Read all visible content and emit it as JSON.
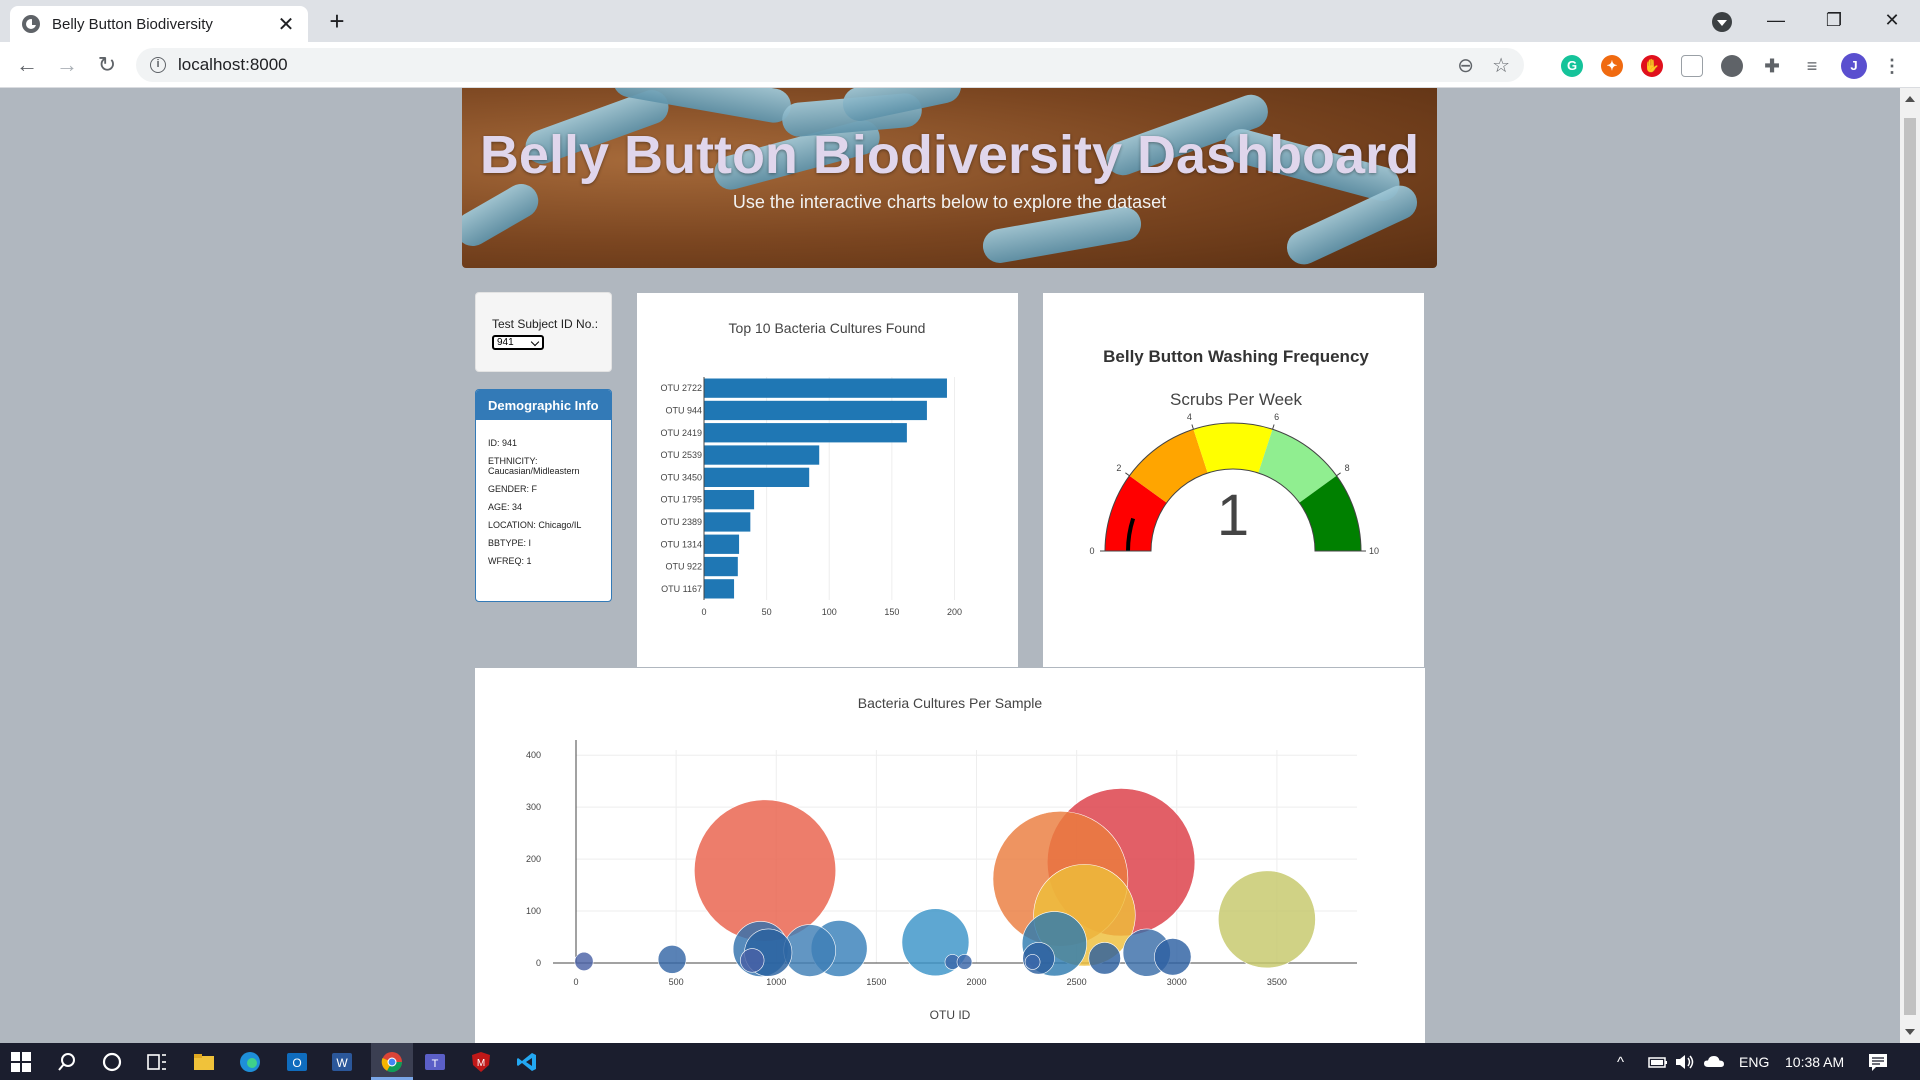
{
  "browser": {
    "tab_title": "Belly Button Biodiversity",
    "tab_close": "✕",
    "new_tab": "+",
    "url": "localhost:8000",
    "window_minimize": "—",
    "window_restore": "❐",
    "window_close": "✕",
    "profile_initial": "J"
  },
  "header": {
    "title": "Belly Button Biodiversity Dashboard",
    "subtitle": "Use the interactive charts below to explore the dataset"
  },
  "selector": {
    "label": "Test Subject ID No.:",
    "value": "941"
  },
  "demographic": {
    "heading": "Demographic Info",
    "rows": [
      "ID: 941",
      "ETHNICITY: Caucasian/Midleastern",
      "GENDER: F",
      "AGE: 34",
      "LOCATION: Chicago/IL",
      "BBTYPE: I",
      "WFREQ: 1"
    ]
  },
  "chart_data": [
    {
      "type": "bar",
      "orientation": "horizontal",
      "title": "Top 10 Bacteria Cultures Found",
      "categories": [
        "OTU 2722",
        "OTU 944",
        "OTU 2419",
        "OTU 2539",
        "OTU 3450",
        "OTU 1795",
        "OTU 2389",
        "OTU 1314",
        "OTU 922",
        "OTU 1167"
      ],
      "values": [
        194,
        178,
        162,
        92,
        84,
        40,
        37,
        28,
        27,
        24
      ],
      "xlim": [
        0,
        210
      ],
      "xticks": [
        0,
        50,
        100,
        150,
        200
      ],
      "color": "#1f77b4",
      "grid": true
    },
    {
      "type": "gauge",
      "title": "Belly Button Washing Frequency",
      "subtitle": "Scrubs Per Week",
      "value": 1,
      "range": [
        0,
        10
      ],
      "tick_labels": [
        "0",
        "2",
        "4",
        "6",
        "8",
        "10"
      ],
      "bands": [
        {
          "from": 0,
          "to": 2,
          "color": "#ff0000"
        },
        {
          "from": 2,
          "to": 4,
          "color": "#ffa500"
        },
        {
          "from": 4,
          "to": 6,
          "color": "#ffff00"
        },
        {
          "from": 6,
          "to": 8,
          "color": "#90ee90"
        },
        {
          "from": 8,
          "to": 10,
          "color": "#008000"
        }
      ],
      "bar_color": "#000000"
    },
    {
      "type": "scatter",
      "subtype": "bubble",
      "title": "Bacteria Cultures Per Sample",
      "xlabel": "OTU ID",
      "ylabel": "",
      "xlim": [
        0,
        3900
      ],
      "ylim": [
        0,
        410
      ],
      "xticks": [
        0,
        500,
        1000,
        1500,
        2000,
        2500,
        3000,
        3500
      ],
      "yticks": [
        0,
        100,
        200,
        300,
        400
      ],
      "grid": true,
      "points": [
        {
          "x": 2722,
          "y": 194,
          "color": "#dc3c46"
        },
        {
          "x": 944,
          "y": 178,
          "color": "#e9604a"
        },
        {
          "x": 2419,
          "y": 162,
          "color": "#ea7d3e"
        },
        {
          "x": 2539,
          "y": 92,
          "color": "#eebe3a"
        },
        {
          "x": 3450,
          "y": 84,
          "color": "#c6c86a"
        },
        {
          "x": 1795,
          "y": 40,
          "color": "#3a94c8"
        },
        {
          "x": 2389,
          "y": 37,
          "color": "#2e7bb0"
        },
        {
          "x": 1314,
          "y": 28,
          "color": "#3880b9"
        },
        {
          "x": 922,
          "y": 27,
          "color": "#3272ad"
        },
        {
          "x": 1167,
          "y": 24,
          "color": "#3f7fb6"
        },
        {
          "x": 960,
          "y": 20,
          "color": "#2a62a0"
        },
        {
          "x": 2850,
          "y": 20,
          "color": "#3a6ea8"
        },
        {
          "x": 2980,
          "y": 12,
          "color": "#2d60a2"
        },
        {
          "x": 2310,
          "y": 9,
          "color": "#2c5f9f"
        },
        {
          "x": 2640,
          "y": 9,
          "color": "#2c5f9f"
        },
        {
          "x": 480,
          "y": 7,
          "color": "#3566a6"
        },
        {
          "x": 880,
          "y": 5,
          "color": "#4a62a6"
        },
        {
          "x": 40,
          "y": 3,
          "color": "#4a62a6"
        },
        {
          "x": 1880,
          "y": 2,
          "color": "#3c68aa"
        },
        {
          "x": 1940,
          "y": 2,
          "color": "#3c68aa"
        },
        {
          "x": 2280,
          "y": 2,
          "color": "#3c68aa"
        }
      ]
    }
  ],
  "taskbar": {
    "language": "ENG",
    "time": "10:38 AM"
  }
}
